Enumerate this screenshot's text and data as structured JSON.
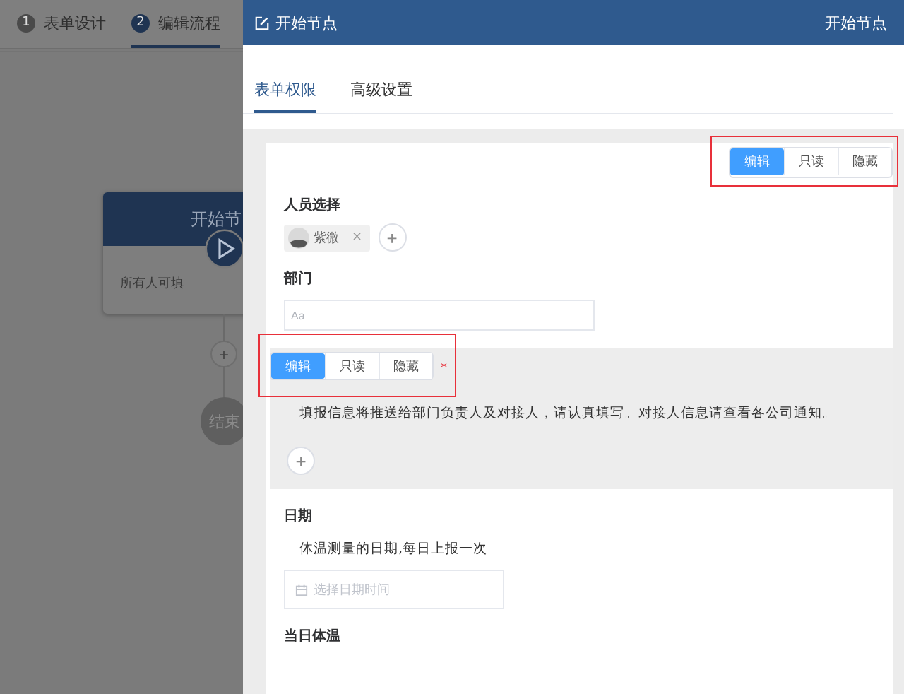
{
  "steps": [
    {
      "number": "1",
      "label": "表单设计",
      "selected": false
    },
    {
      "number": "2",
      "label": "编辑流程",
      "selected": true
    }
  ],
  "flow": {
    "start_node": {
      "title": "开始节",
      "subtitle": "所有人可填"
    },
    "add_symbol": "+",
    "end_node": "结束"
  },
  "drawer": {
    "title": "开始节点",
    "title_right": "开始节点",
    "tabs": [
      {
        "label": "表单权限",
        "selected": true
      },
      {
        "label": "高级设置",
        "selected": false
      }
    ],
    "top_permission": [
      {
        "label": "编辑",
        "selected": true
      },
      {
        "label": "只读",
        "selected": false
      },
      {
        "label": "隐藏",
        "selected": false
      }
    ],
    "fields": [
      {
        "kind": "members",
        "label": "人员选择",
        "member": "紫微",
        "remove": "×",
        "add": "+"
      },
      {
        "kind": "text",
        "label": "部门",
        "placeholder": "Aa"
      },
      {
        "kind": "section",
        "required_mark": "*",
        "description": "填报信息将推送给部门负责人及对接人，请认真填写。对接人信息请查看各公司通知。",
        "add": "+",
        "permission": [
          {
            "label": "编辑",
            "selected": true
          },
          {
            "label": "只读",
            "selected": false
          },
          {
            "label": "隐藏",
            "selected": false
          }
        ]
      },
      {
        "kind": "date",
        "label": "日期",
        "description": "体温测量的日期,每日上报一次",
        "placeholder": "选择日期时间"
      },
      {
        "kind": "heading",
        "label": "当日体温"
      }
    ]
  }
}
